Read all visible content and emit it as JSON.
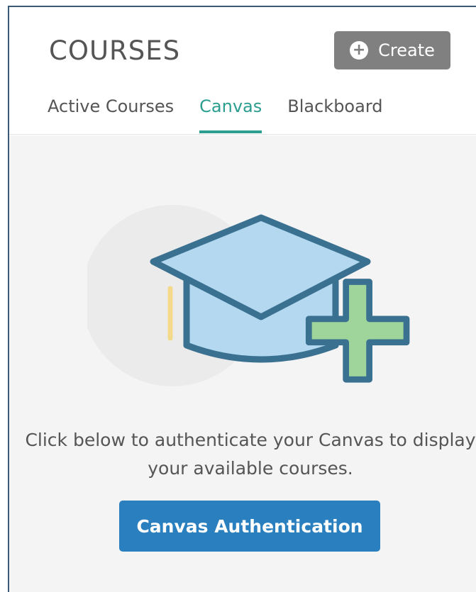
{
  "header": {
    "title": "COURSES",
    "create_label": "Create"
  },
  "tabs": [
    {
      "label": "Active Courses",
      "active": false
    },
    {
      "label": "Canvas",
      "active": true
    },
    {
      "label": "Blackboard",
      "active": false
    }
  ],
  "empty_state": {
    "icon": "graduation-cap-plus-icon",
    "message": "Click below to authenticate your Canvas to display your available courses.",
    "button_label": "Canvas Authentication"
  },
  "colors": {
    "accent": "#2b9e8f",
    "primary_button": "#2a7fbf",
    "create_button": "#808080",
    "cap_fill": "#b3d8f0",
    "cap_stroke": "#3a7090",
    "plus_fill": "#9fd49a"
  }
}
